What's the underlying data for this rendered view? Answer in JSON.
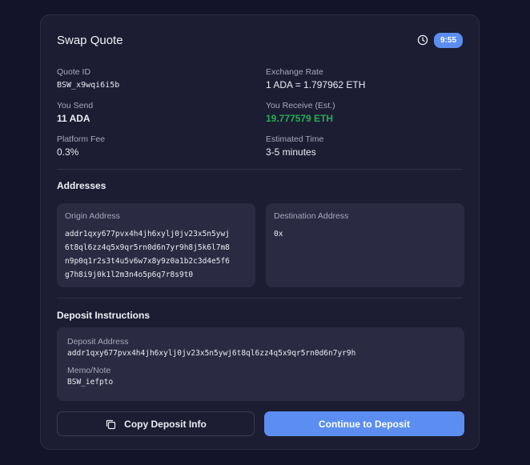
{
  "header": {
    "title": "Swap Quote",
    "timer": "9:55"
  },
  "details": {
    "quote_id_label": "Quote ID",
    "quote_id": "BSW_x9wqi6i5b",
    "exchange_rate_label": "Exchange Rate",
    "exchange_rate": "1 ADA = 1.797962 ETH",
    "you_send_label": "You Send",
    "you_send": "11 ADA",
    "you_receive_label": "You Receive (Est.)",
    "you_receive": "19.777579 ETH",
    "platform_fee_label": "Platform Fee",
    "platform_fee": "0.3%",
    "estimated_time_label": "Estimated Time",
    "estimated_time": "3-5 minutes"
  },
  "addresses": {
    "title": "Addresses",
    "origin_label": "Origin Address",
    "origin_lines": [
      "addr1qxy677pvx4h4jh6xylj0jv23x5n5ywj",
      "6t8ql6zz4q5x9qr5rn0d6n7yr9h8j5k6l7m8",
      "n9p0q1r2s3t4u5v6w7x8y9z0a1b2c3d4e5f6",
      "g7h8i9j0k1l2m3n4o5p6q7r8s9t0"
    ],
    "destination_label": "Destination Address",
    "destination": "0x"
  },
  "deposit": {
    "title": "Deposit Instructions",
    "address_label": "Deposit Address",
    "address": "addr1qxy677pvx4h4jh6xylj0jv23x5n5ywj6t8ql6zz4q5x9qr5rn0d6n7yr9h",
    "memo_label": "Memo/Note",
    "memo": "BSW_iefpto"
  },
  "actions": {
    "copy_label": "Copy Deposit Info",
    "continue_label": "Continue to Deposit"
  },
  "colors": {
    "accent": "#5b8ef0",
    "receive_green": "#22b04f",
    "card_bg": "#1c1c33",
    "page_bg": "#13132a"
  },
  "icons": {
    "timer": "clock-icon",
    "copy": "copy-icon"
  }
}
